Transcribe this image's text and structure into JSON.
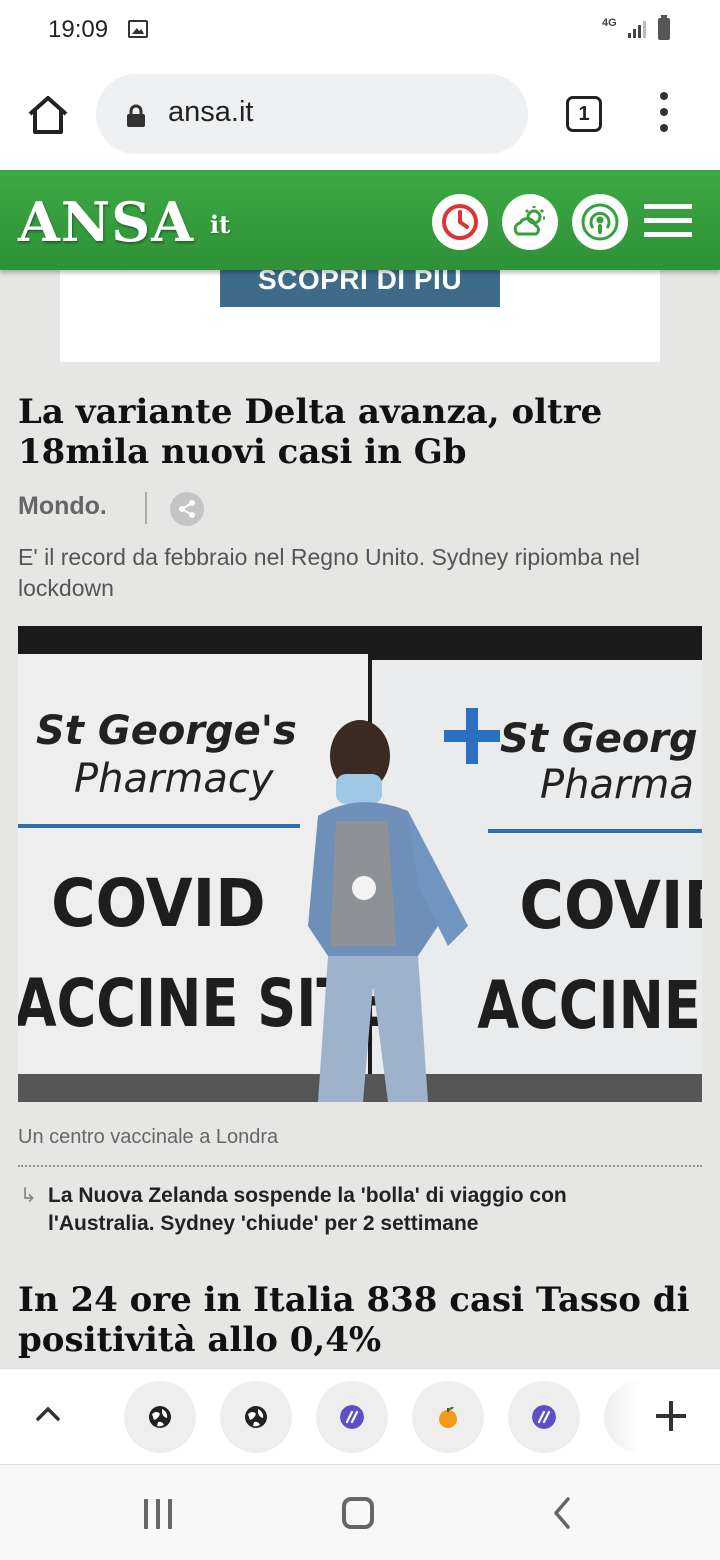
{
  "status_bar": {
    "time": "19:09",
    "network": "4G"
  },
  "browser": {
    "url": "ansa.it",
    "tab_count": "1"
  },
  "site": {
    "logo": "ANSA",
    "logo_suffix": "it",
    "brand_color": "#34a03e"
  },
  "ad": {
    "button_label": "SCOPRI DI PIU"
  },
  "article": {
    "headline": "La variante Delta avanza, oltre 18mila nuovi casi in Gb",
    "section": "Mondo.",
    "summary": "E' il record da febbraio nel Regno Unito. Sydney ripiomba nel lockdown",
    "image": {
      "sign_left_name": "St George's",
      "sign_left_sub": "Pharmacy",
      "sign_left_line1": "COVID",
      "sign_left_line2": "ACCINE SITE",
      "sign_right_name": "St Georg",
      "sign_right_sub": "Pharma",
      "sign_right_line1": "COVID",
      "sign_right_line2": "ACCINE SI"
    },
    "caption": "Un centro vaccinale a Londra",
    "related": "La Nuova Zelanda sospende la 'bolla' di viaggio con l'Australia. Sydney 'chiude' per 2 settimane"
  },
  "next_article": {
    "headline": "In 24 ore in Italia 838 casi Tasso di positività allo 0,4%"
  },
  "bottom_tabs": {
    "icons": [
      "globe-icon",
      "globe-icon",
      "slash-icon",
      "orange-icon",
      "slash-icon"
    ]
  }
}
